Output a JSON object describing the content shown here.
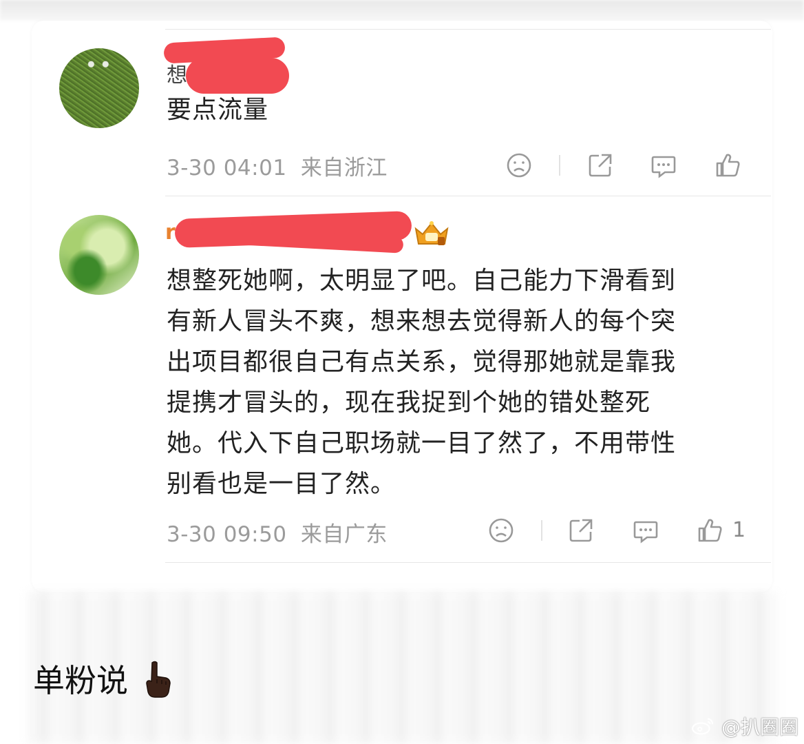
{
  "comments": [
    {
      "name_visible_prefix": "想",
      "text": "要点流量",
      "time": "3-30 04:01",
      "location": "来自浙江",
      "like_count": ""
    },
    {
      "name_visible_prefix": "r",
      "badge_icon": "crown-badge-icon",
      "text": "想整死她啊，太明显了吧。自己能力下滑看到有新人冒头不爽，想来想去觉得新人的每个突出项目都很自己有点关系，觉得那她就是靠我提携才冒头的，现在我捉到个她的错处整死她。代入下自己职场就一目了然了，不用带性别看也是一目了然。",
      "time": "3-30 09:50",
      "location": "来自广东",
      "like_count": "1"
    }
  ],
  "comment2_lines": [
    "想整死她啊，太明显了吧。自己能力下滑看到",
    "有新人冒头不爽，想来想去觉得新人的每个突",
    "出项目都很自己有点关系，觉得那她就是靠我",
    "提携才冒头的，现在我捉到个她的错处整死",
    "她。代入下自己职场就一目了然了，不用带性",
    "别看也是一目了然。"
  ],
  "caption": "单粉说",
  "watermark": "@扒圈圈",
  "colors": {
    "accent_name": "#e8822f",
    "redaction": "#f24a52",
    "meta": "#9b9b9b"
  }
}
